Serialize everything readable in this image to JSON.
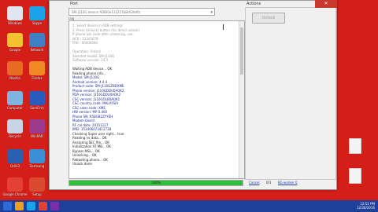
{
  "desktop_icons": [
    {
      "label": "Windows",
      "color": "#dfe6ef"
    },
    {
      "label": "Google",
      "color": "#f2c230"
    },
    {
      "label": "Mozilla",
      "color": "#e86b24"
    },
    {
      "label": "Computer",
      "color": "#7fb3e0"
    },
    {
      "label": "Recycle",
      "color": "#c7d5e6"
    },
    {
      "label": "Odin3",
      "color": "#2b5fb0"
    },
    {
      "label": "Google Chrome",
      "color": "#e34133"
    },
    {
      "label": "Skype",
      "color": "#1aa3e8"
    },
    {
      "label": "Network",
      "color": "#3f7fc6"
    },
    {
      "label": "Firefox",
      "color": "#f08a24"
    },
    {
      "label": "SamFirm",
      "color": "#2a5cbf"
    },
    {
      "label": "WinRAR",
      "color": "#9c3a8c"
    },
    {
      "label": "Samsung",
      "color": "#3b8fd6"
    },
    {
      "label": "Setup",
      "color": "#d94a30"
    }
  ],
  "window": {
    "port_label": "Port",
    "port_value": "SM-J110G device ADB(0e111257b8c02b00)",
    "actions_label": "Actions",
    "unlock_button": "Unlock",
    "close_label": "✕",
    "log_label": "Log",
    "log_lines": [
      {
        "t": "1. Select device in ADB settings",
        "c": "gray"
      },
      {
        "t": "2. Press (Unlock) button (for direct unlock)",
        "c": "gray"
      },
      {
        "t": "   If phone ask code after unlocking, use:",
        "c": "gray"
      },
      {
        "t": "   NCK  : 12345678",
        "c": "gray"
      },
      {
        "t": "   FRK  : 00000000",
        "c": "gray"
      },
      {
        "t": "",
        "c": "gray"
      },
      {
        "t": "Operation: Unlock",
        "c": "gray"
      },
      {
        "t": "Selected model: SM-J110G",
        "c": "gray"
      },
      {
        "t": "Software version: 24.3",
        "c": "gray"
      },
      {
        "t": "",
        "c": "gray"
      },
      {
        "t": "Waiting ADB device... OK",
        "c": "black"
      },
      {
        "t": "Reading phone info...",
        "c": "black"
      },
      {
        "t": "Model: SM-J110G",
        "c": "navy"
      },
      {
        "t": "Android version: 4.4.4",
        "c": "navy"
      },
      {
        "t": "Product code: SM-J110GZBDXME",
        "c": "navy"
      },
      {
        "t": "Phone version: J110GDDU0AOK2",
        "c": "navy"
      },
      {
        "t": "PDA version: J110GDDU0AOK2",
        "c": "navy"
      },
      {
        "t": "CSC version: J110GOLB0AOK1",
        "c": "navy"
      },
      {
        "t": "CSC country code: MALAYSIA",
        "c": "navy"
      },
      {
        "t": "CSC sales code: XME",
        "c": "navy"
      },
      {
        "t": "HW version: MP 0.400",
        "c": "navy"
      },
      {
        "t": "Phone SN: R58GB2ZYYEH",
        "c": "navy"
      },
      {
        "t": "Modem board:",
        "c": "navy"
      },
      {
        "t": "RF cal date: 20151127",
        "c": "navy"
      },
      {
        "t": "IMEI: 353406073412738",
        "c": "navy"
      },
      {
        "t": "Checking Super user right... true",
        "c": "black"
      },
      {
        "t": "Reading nv data... OK",
        "c": "black"
      },
      {
        "t": "Analyzing SEC file... OK",
        "c": "black"
      },
      {
        "t": "Initialization AT MB... OK",
        "c": "black"
      },
      {
        "t": "Bypass MSL... OK",
        "c": "black"
      },
      {
        "t": "Unlocking... OK",
        "c": "black"
      },
      {
        "t": "Rebooting phone... OK",
        "c": "black"
      },
      {
        "t": "Unlock done",
        "c": "black"
      }
    ],
    "progress_value": 1.0,
    "progress_text": "100%",
    "status_cancel": "Cancel",
    "status_progress": "0/1",
    "status_mode": "BG worker 0"
  },
  "taskbar": {
    "time": "12:51 PM",
    "date": "12/30/2016",
    "item_colors": [
      "#2f6bd4",
      "#f0a020",
      "#1aa3e8",
      "#e34133",
      "#7a2fa8"
    ]
  }
}
